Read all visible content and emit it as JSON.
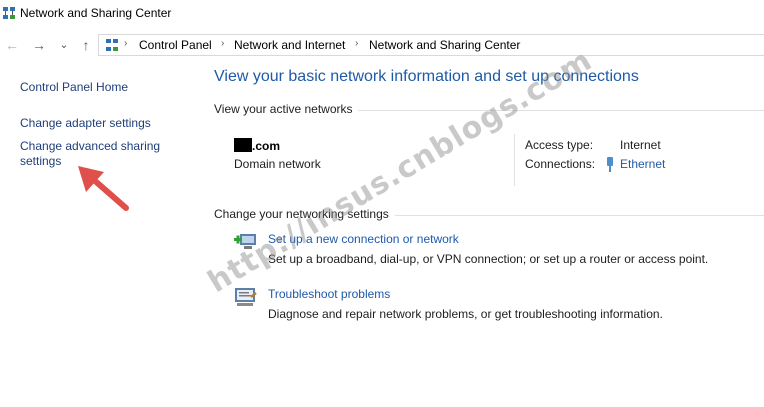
{
  "window": {
    "title": "Network and Sharing Center"
  },
  "nav": {
    "back": "←",
    "forward": "→",
    "recent": "⌄",
    "up": "↑"
  },
  "breadcrumb": [
    "Control Panel",
    "Network and Internet",
    "Network and Sharing Center"
  ],
  "sidebar": {
    "home": "Control Panel Home",
    "adapter": "Change adapter settings",
    "advanced_line1": "Change advanced sharing",
    "advanced_line2": "settings"
  },
  "main": {
    "title": "View your basic network information and set up connections",
    "active_header": "View your active networks",
    "network": {
      "name_suffix": ".com",
      "type": "Domain network"
    },
    "access_type_label": "Access type:",
    "access_type_value": "Internet",
    "connections_label": "Connections:",
    "connections_value": "Ethernet",
    "change_header": "Change your networking settings",
    "tasks": [
      {
        "link": "Set up a new connection or network",
        "desc": "Set up a broadband, dial-up, or VPN connection; or set up a router or access point."
      },
      {
        "link": "Troubleshoot problems",
        "desc": "Diagnose and repair network problems, or get troubleshooting information."
      }
    ]
  },
  "watermark": "http://insus.cnblogs.com",
  "colors": {
    "link": "#1e5aa8",
    "sidebar_link": "#1e3e7a",
    "arrow": "#e0504a"
  }
}
